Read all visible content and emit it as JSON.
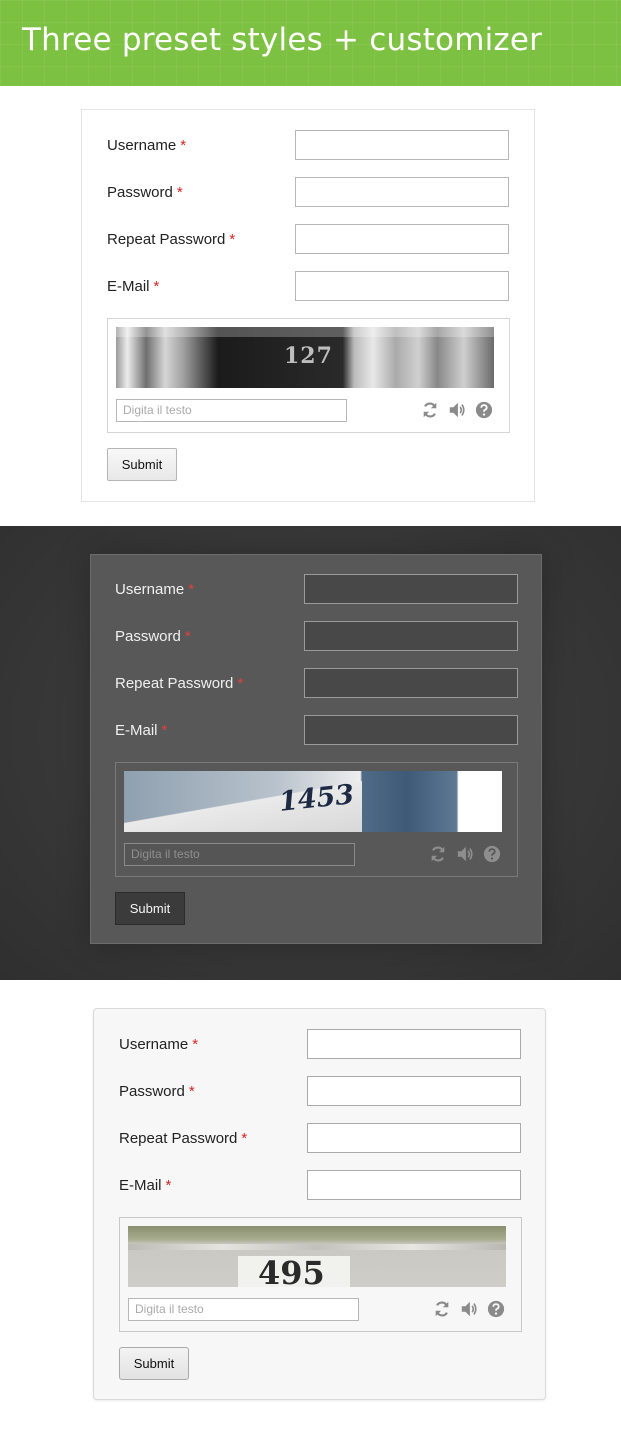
{
  "header": {
    "title": "Three preset styles + customizer"
  },
  "colors": {
    "banner_green": "#7dc142",
    "required_star": "#dd2222",
    "dark_bg": "#3a3a3a",
    "dark_panel": "#585858"
  },
  "forms": [
    {
      "style": "light",
      "fields": [
        {
          "label": "Username",
          "required": "*",
          "value": ""
        },
        {
          "label": "Password",
          "required": "*",
          "value": ""
        },
        {
          "label": "Repeat Password",
          "required": "*",
          "value": ""
        },
        {
          "label": "E-Mail",
          "required": "*",
          "value": ""
        }
      ],
      "captcha": {
        "number": "127",
        "placeholder": "Digita il testo",
        "icons": [
          "refresh-icon",
          "audio-icon",
          "help-icon"
        ]
      },
      "submit_label": "Submit"
    },
    {
      "style": "dark",
      "fields": [
        {
          "label": "Username",
          "required": "*",
          "value": ""
        },
        {
          "label": "Password",
          "required": "*",
          "value": ""
        },
        {
          "label": "Repeat Password",
          "required": "*",
          "value": ""
        },
        {
          "label": "E-Mail",
          "required": "*",
          "value": ""
        }
      ],
      "captcha": {
        "number": "1453",
        "placeholder": "Digita il testo",
        "icons": [
          "refresh-icon",
          "audio-icon",
          "help-icon"
        ]
      },
      "submit_label": "Submit"
    },
    {
      "style": "rounded",
      "fields": [
        {
          "label": "Username",
          "required": "*",
          "value": ""
        },
        {
          "label": "Password",
          "required": "*",
          "value": ""
        },
        {
          "label": "Repeat Password",
          "required": "*",
          "value": ""
        },
        {
          "label": "E-Mail",
          "required": "*",
          "value": ""
        }
      ],
      "captcha": {
        "number": "495",
        "placeholder": "Digita il testo",
        "icons": [
          "refresh-icon",
          "audio-icon",
          "help-icon"
        ]
      },
      "submit_label": "Submit"
    }
  ]
}
